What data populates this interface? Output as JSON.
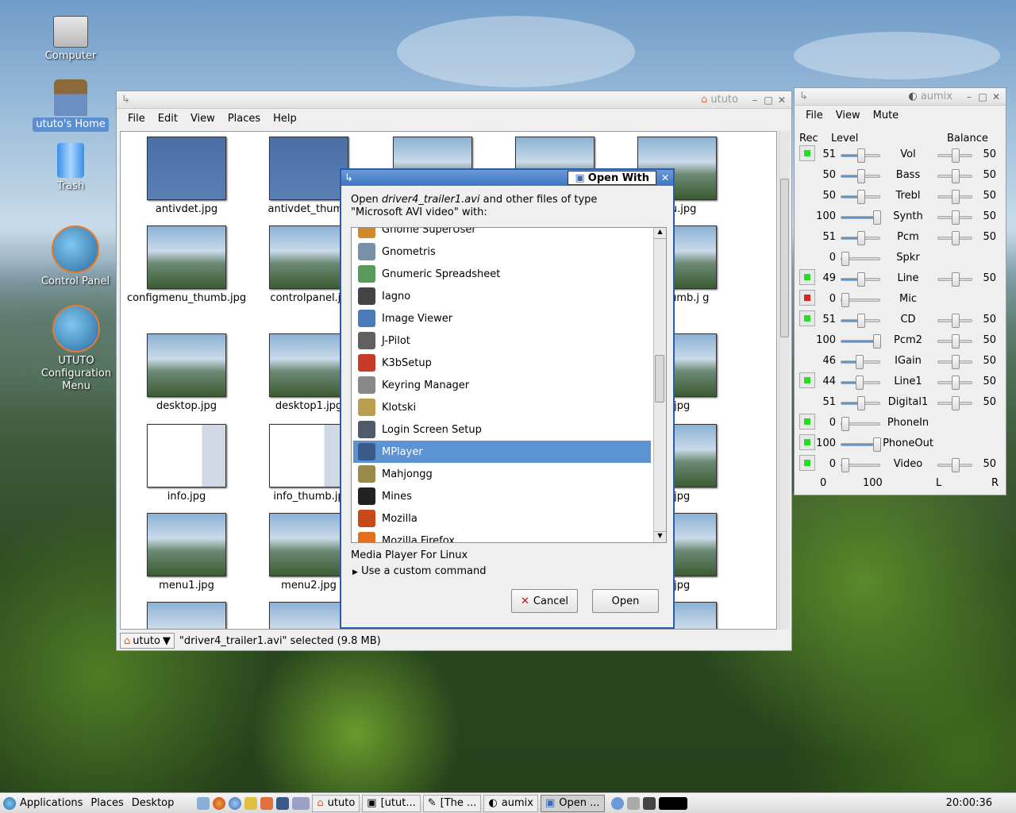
{
  "desktop": {
    "icons": [
      {
        "label": "Computer"
      },
      {
        "label": "ututo's Home"
      },
      {
        "label": "Trash"
      },
      {
        "label": "Control Panel"
      },
      {
        "label": "UTUTO Configuration Menu"
      }
    ]
  },
  "filemanager": {
    "title": "ututo",
    "menu": [
      "File",
      "Edit",
      "View",
      "Places",
      "Help"
    ],
    "files": [
      "antivdet.jpg",
      "antivdet_thumb",
      "",
      "",
      "enu.jpg",
      "configmenu_thumb.jpg",
      "controlpanel.jp",
      "",
      "",
      "el_thumb.j g",
      "desktop.jpg",
      "desktop1.jpg",
      "",
      "",
      "p.jpg",
      "info.jpg",
      "info_thumb.jp",
      "",
      "",
      "u.jpg",
      "menu1.jpg",
      "menu2.jpg",
      "",
      "",
      "5.jpg"
    ],
    "location": "ututo",
    "status": "\"driver4_trailer1.avi\" selected (9.8 MB)"
  },
  "dialog": {
    "title": "Open With",
    "prompt_prefix": "Open ",
    "prompt_file": "driver4_trailer1.avi",
    "prompt_suffix": " and other files of type",
    "prompt_type": "\"Microsoft AVI video\" with:",
    "apps": [
      {
        "name": "Gnome SuperUser",
        "color": "#d08a2a"
      },
      {
        "name": "Gnometris",
        "color": "#7a8fa8"
      },
      {
        "name": "Gnumeric Spreadsheet",
        "color": "#5a9a5a"
      },
      {
        "name": "Iagno",
        "color": "#444444"
      },
      {
        "name": "Image Viewer",
        "color": "#4a7ab8"
      },
      {
        "name": "J-Pilot",
        "color": "#606060"
      },
      {
        "name": "K3bSetup",
        "color": "#c83a2a"
      },
      {
        "name": "Keyring Manager",
        "color": "#888888"
      },
      {
        "name": "Klotski",
        "color": "#b8a050"
      },
      {
        "name": "Login Screen Setup",
        "color": "#505a6a"
      },
      {
        "name": "MPlayer",
        "color": "#3a5a8a"
      },
      {
        "name": "Mahjongg",
        "color": "#9a8a4a"
      },
      {
        "name": "Mines",
        "color": "#222222"
      },
      {
        "name": "Mozilla",
        "color": "#c84a1a"
      },
      {
        "name": "Mozilla Firefox",
        "color": "#e07020"
      }
    ],
    "selected_app": "MPlayer",
    "description": "Media Player For Linux",
    "custom_command": "Use a custom command",
    "cancel_label": "Cancel",
    "open_label": "Open"
  },
  "mixer": {
    "title": "aumix",
    "menu": [
      "File",
      "View",
      "Mute"
    ],
    "headers": {
      "rec": "Rec",
      "level": "Level",
      "balance": "Balance"
    },
    "channels": [
      {
        "name": "Vol",
        "level": 51,
        "balance": 50,
        "rec": "on"
      },
      {
        "name": "Bass",
        "level": 50,
        "balance": 50,
        "rec": "none"
      },
      {
        "name": "Trebl",
        "level": 50,
        "balance": 50,
        "rec": "none"
      },
      {
        "name": "Synth",
        "level": 100,
        "balance": 50,
        "rec": "none"
      },
      {
        "name": "Pcm",
        "level": 51,
        "balance": 50,
        "rec": "none"
      },
      {
        "name": "Spkr",
        "level": 0,
        "balance": null,
        "rec": "none"
      },
      {
        "name": "Line",
        "level": 49,
        "balance": 50,
        "rec": "on"
      },
      {
        "name": "Mic",
        "level": 0,
        "balance": null,
        "rec": "red"
      },
      {
        "name": "CD",
        "level": 51,
        "balance": 50,
        "rec": "on"
      },
      {
        "name": "Pcm2",
        "level": 100,
        "balance": 50,
        "rec": "none"
      },
      {
        "name": "IGain",
        "level": 46,
        "balance": 50,
        "rec": "none"
      },
      {
        "name": "Line1",
        "level": 44,
        "balance": 50,
        "rec": "on"
      },
      {
        "name": "Digital1",
        "level": 51,
        "balance": 50,
        "rec": "none"
      },
      {
        "name": "PhoneIn",
        "level": 0,
        "balance": null,
        "rec": "on"
      },
      {
        "name": "PhoneOut",
        "level": 100,
        "balance": null,
        "rec": "on"
      },
      {
        "name": "Video",
        "level": 0,
        "balance": 50,
        "rec": "on"
      }
    ],
    "footer": {
      "min": "0",
      "max": "100",
      "left": "L",
      "right": "R"
    }
  },
  "panel": {
    "menus": [
      "Applications",
      "Places",
      "Desktop"
    ],
    "tasks": [
      "ututo",
      "[utut...",
      "[The ...",
      "aumix",
      "Open ..."
    ],
    "clock": "20:00:36"
  }
}
